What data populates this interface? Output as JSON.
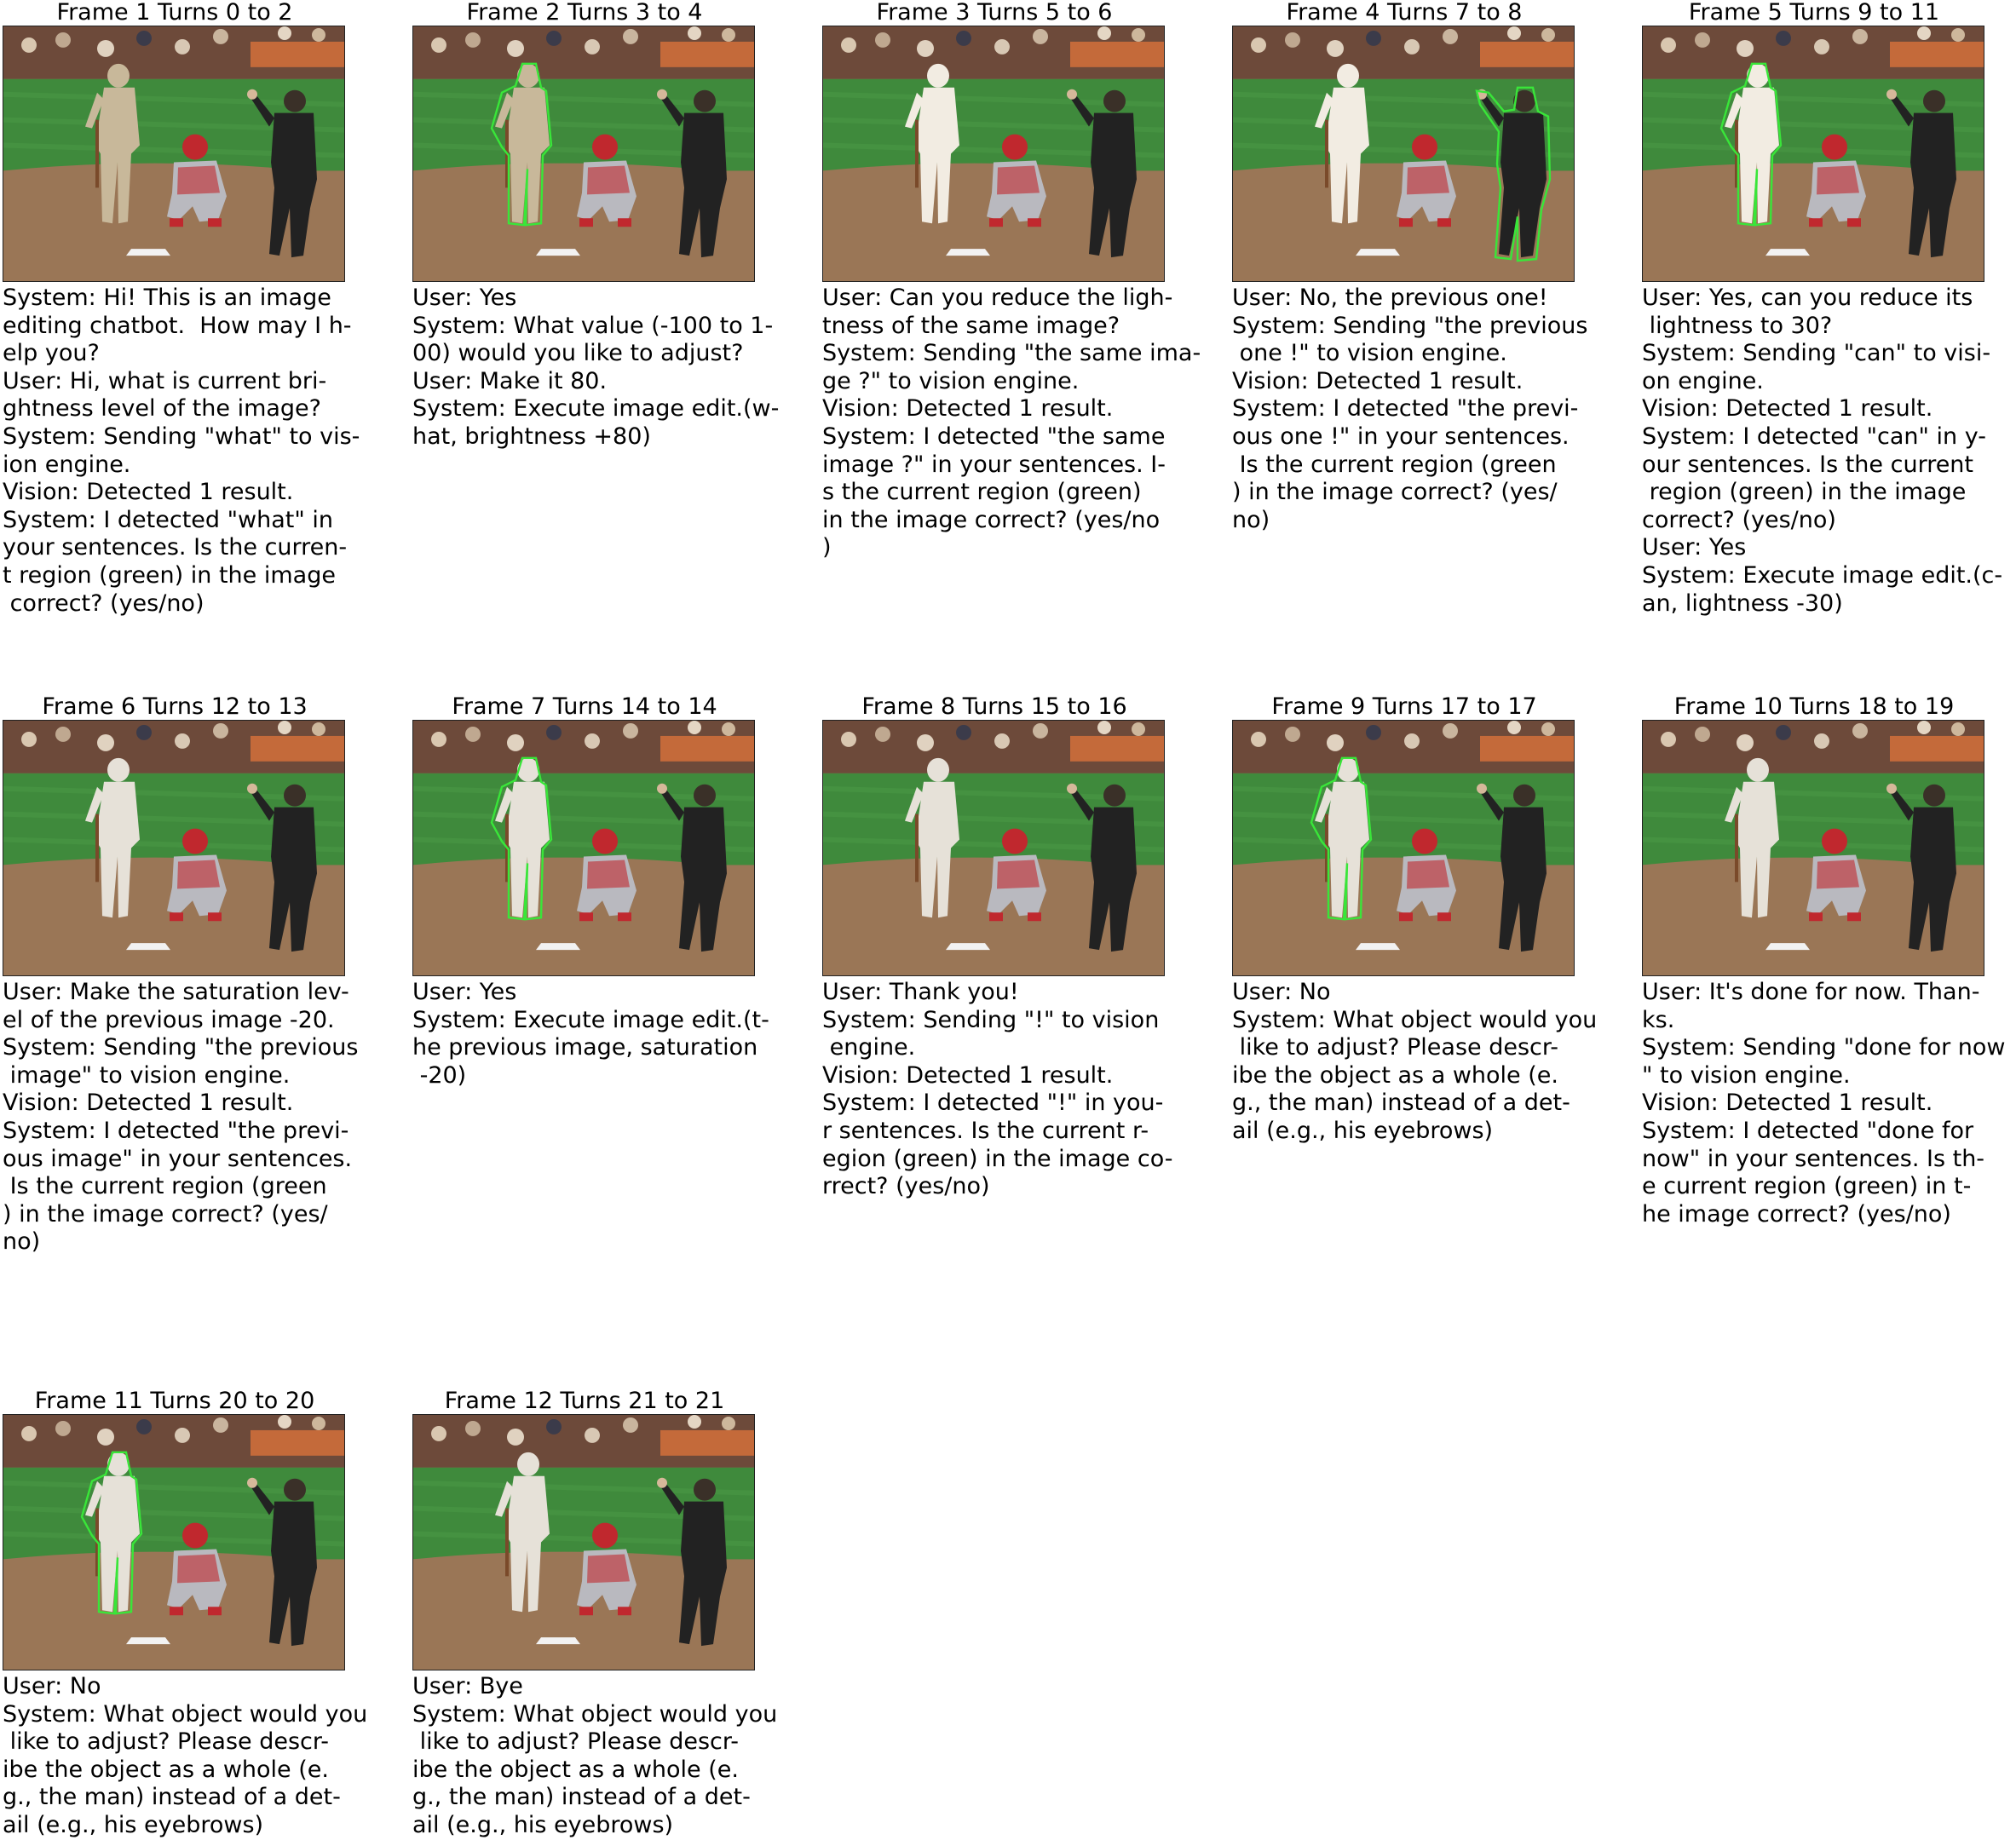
{
  "frames": [
    {
      "title": "Frame 1 Turns 0 to 2",
      "outline": "none",
      "pitcher": "normal",
      "umpire": "normal",
      "text": "System: Hi! This is an image\nediting chatbot.  How may I h-\nelp you?\nUser: Hi, what is current bri-\nghtness level of the image?\nSystem: Sending \"what\" to vis-\nion engine.\nVision: Detected 1 result.\nSystem: I detected \"what\" in\nyour sentences. Is the curren-\nt region (green) in the image\n correct? (yes/no)"
    },
    {
      "title": "Frame 2 Turns 3 to 4",
      "outline": "batter",
      "pitcher": "normal",
      "umpire": "normal",
      "text": "User: Yes\nSystem: What value (-100 to 1-\n00) would you like to adjust?\nUser: Make it 80.\nSystem: Execute image edit.(w-\nhat, brightness +80)"
    },
    {
      "title": "Frame 3 Turns 5 to 6",
      "outline": "none",
      "pitcher": "bright",
      "umpire": "normal",
      "text": "User: Can you reduce the ligh-\ntness of the same image?\nSystem: Sending \"the same ima-\nge ?\" to vision engine.\nVision: Detected 1 result.\nSystem: I detected \"the same\nimage ?\" in your sentences. I-\ns the current region (green)\nin the image correct? (yes/no\n)"
    },
    {
      "title": "Frame 4 Turns 7 to 8",
      "outline": "umpire",
      "pitcher": "bright",
      "umpire": "normal",
      "text": "User: No, the previous one!\nSystem: Sending \"the previous\n one !\" to vision engine.\nVision: Detected 1 result.\nSystem: I detected \"the previ-\nous one !\" in your sentences.\n Is the current region (green\n) in the image correct? (yes/\nno)"
    },
    {
      "title": "Frame 5 Turns 9 to 11",
      "outline": "batter",
      "pitcher": "bright",
      "umpire": "normal",
      "text": "User: Yes, can you reduce its\n lightness to 30?\nSystem: Sending \"can\" to visi-\non engine.\nVision: Detected 1 result.\nSystem: I detected \"can\" in y-\nour sentences. Is the current\n region (green) in the image\ncorrect? (yes/no)\nUser: Yes\nSystem: Execute image edit.(c-\nan, lightness -30)"
    },
    {
      "title": "Frame 6 Turns 12 to 13",
      "outline": "none",
      "pitcher": "light",
      "umpire": "normal",
      "text": "User: Make the saturation lev-\nel of the previous image -20.\nSystem: Sending \"the previous\n image\" to vision engine.\nVision: Detected 1 result.\nSystem: I detected \"the previ-\nous image\" in your sentences.\n Is the current region (green\n) in the image correct? (yes/\nno)"
    },
    {
      "title": "Frame 7 Turns 14 to 14",
      "outline": "batter",
      "pitcher": "light",
      "umpire": "normal",
      "text": "User: Yes\nSystem: Execute image edit.(t-\nhe previous image, saturation\n -20)"
    },
    {
      "title": "Frame 8 Turns 15 to 16",
      "outline": "none",
      "pitcher": "light",
      "umpire": "normal",
      "text": "User: Thank you!\nSystem: Sending \"!\" to vision\n engine.\nVision: Detected 1 result.\nSystem: I detected \"!\" in you-\nr sentences. Is the current r-\negion (green) in the image co-\nrrect? (yes/no)"
    },
    {
      "title": "Frame 9 Turns 17 to 17",
      "outline": "batter",
      "pitcher": "light",
      "umpire": "normal",
      "text": "User: No\nSystem: What object would you\n like to adjust? Please descr-\nibe the object as a whole (e.\ng., the man) instead of a det-\nail (e.g., his eyebrows)"
    },
    {
      "title": "Frame 10 Turns 18 to 19",
      "outline": "none",
      "pitcher": "light",
      "umpire": "normal",
      "text": "User: It's done for now. Than-\nks.\nSystem: Sending \"done for now\n\" to vision engine.\nVision: Detected 1 result.\nSystem: I detected \"done for\nnow\" in your sentences. Is th-\ne current region (green) in t-\nhe image correct? (yes/no)"
    },
    {
      "title": "Frame 11 Turns 20 to 20",
      "outline": "batter",
      "pitcher": "light",
      "umpire": "normal",
      "text": "User: No\nSystem: What object would you\n like to adjust? Please descr-\nibe the object as a whole (e.\ng., the man) instead of a det-\nail (e.g., his eyebrows)"
    },
    {
      "title": "Frame 12 Turns 21 to 21",
      "outline": "none",
      "pitcher": "light",
      "umpire": "normal",
      "text": "User: Bye\nSystem: What object would you\n like to adjust? Please descr-\nibe the object as a whole (e.\ng., the man) instead of a det-\nail (e.g., his eyebrows)"
    }
  ],
  "colors": {
    "outline": "#39e639",
    "grass": "#3f8a3c",
    "dirt": "#9a7656",
    "stands": "#6d4a3a",
    "batter_normal": "#c8b89a",
    "batter_bright": "#f2ece2",
    "batter_light": "#e6e1d8",
    "catcher_red": "#c0282e",
    "umpire": "#222222"
  }
}
